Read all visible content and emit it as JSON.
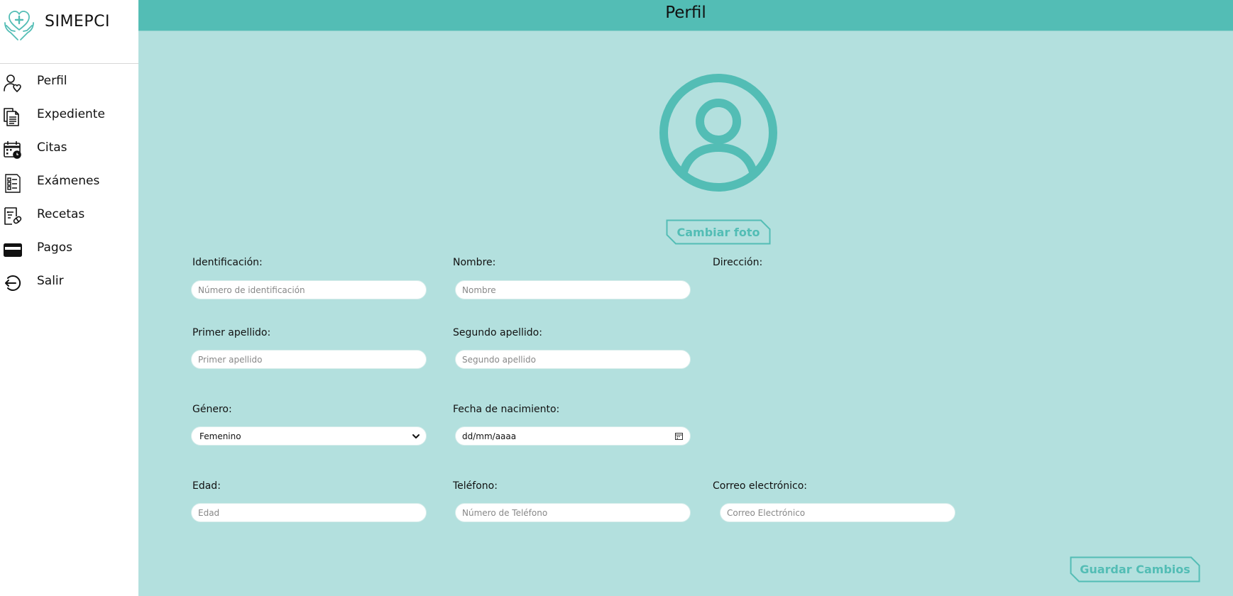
{
  "brand": {
    "name": "SIMEPCI",
    "logo_icon": "hands-heart-cross-icon"
  },
  "sidebar": {
    "items": [
      {
        "label": "Perfil",
        "icon": "user-heart-icon"
      },
      {
        "label": "Expediente",
        "icon": "documents-icon"
      },
      {
        "label": "Citas",
        "icon": "calendar-clock-icon"
      },
      {
        "label": "Exámenes",
        "icon": "checklist-icon"
      },
      {
        "label": "Recetas",
        "icon": "prescription-icon"
      },
      {
        "label": "Pagos",
        "icon": "credit-card-icon"
      },
      {
        "label": "Salir",
        "icon": "logout-icon"
      }
    ]
  },
  "header": {
    "title": "Perfil"
  },
  "profile": {
    "avatar_icon": "user-circle-icon",
    "change_photo_label": "Cambiar foto"
  },
  "form": {
    "identification": {
      "label": "Identificación:",
      "placeholder": "Número de identificación"
    },
    "name": {
      "label": "Nombre:",
      "placeholder": "Nombre"
    },
    "address": {
      "label": "Dirección:"
    },
    "first_surname": {
      "label": "Primer apellido:",
      "placeholder": "Primer apellido"
    },
    "second_surname": {
      "label": "Segundo apellido:",
      "placeholder": "Segundo apellido"
    },
    "gender": {
      "label": "Género:",
      "value": "Femenino"
    },
    "birthdate": {
      "label": "Fecha de nacimiento:",
      "value": "dd/mm/aaaa"
    },
    "age": {
      "label": "Edad:",
      "placeholder": "Edad"
    },
    "phone": {
      "label": "Teléfono:",
      "placeholder": "Número de Teléfono"
    },
    "email": {
      "label": "Correo electrónico:",
      "placeholder": "Correo Electrónico"
    }
  },
  "actions": {
    "save_label": "Guardar Cambios"
  },
  "colors": {
    "accent": "#53bdb5",
    "background": "#b3e0de",
    "sidebar": "#ffffff"
  }
}
